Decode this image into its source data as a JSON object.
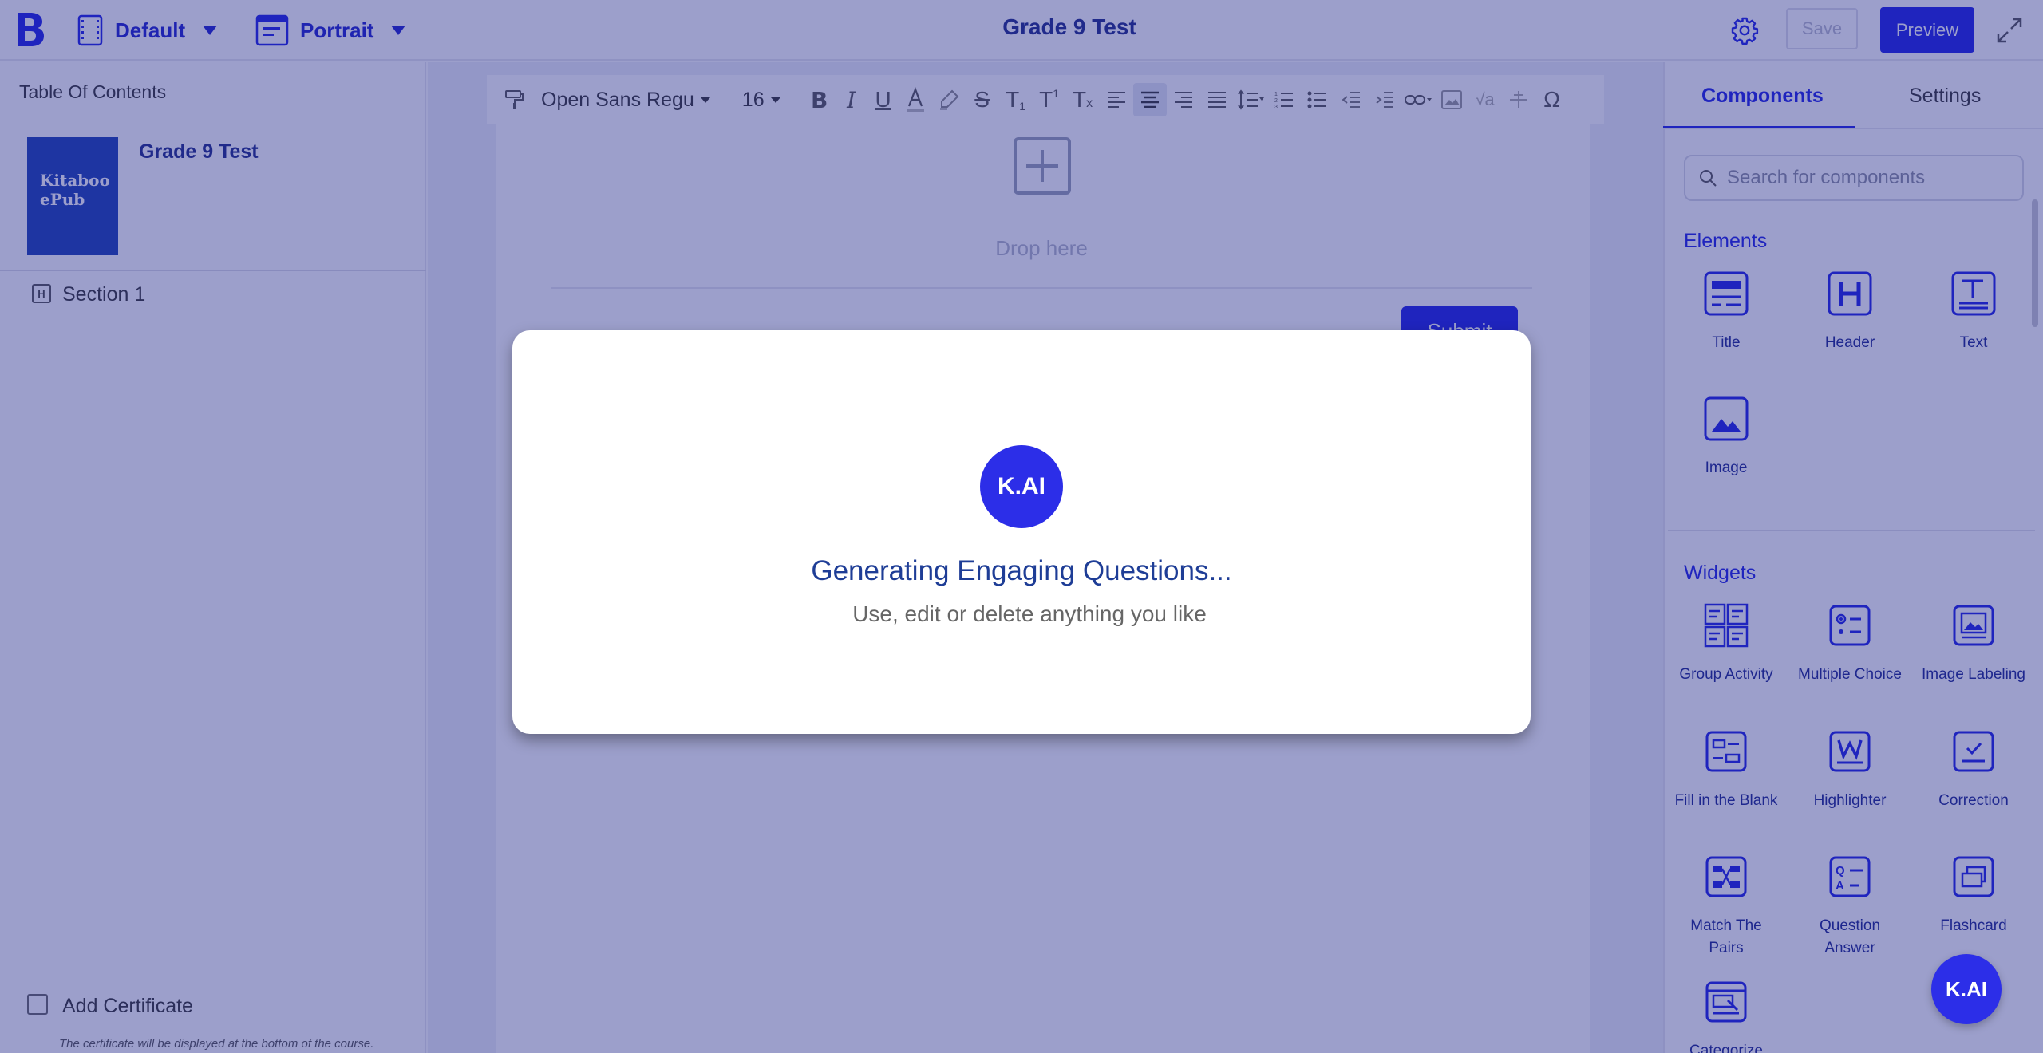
{
  "topbar": {
    "theme_label": "Default",
    "layout_label": "Portrait",
    "title": "Grade 9 Test",
    "save_label": "Save",
    "preview_label": "Preview"
  },
  "left_panel": {
    "toc_title": "Table Of Contents",
    "cover_text_line1": "Kitaboo",
    "cover_text_line2": "ePub",
    "book_title": "Grade 9 Test",
    "section_icon_letter": "H",
    "sections": [
      {
        "label": "Section 1"
      }
    ],
    "certificate_label": "Add Certificate",
    "certificate_note": "The certificate will be displayed at the bottom of the course."
  },
  "toolbar": {
    "font_family": "Open Sans Regu",
    "font_size": "16"
  },
  "canvas": {
    "drop_label": "Drop here",
    "submit_label": "Submit"
  },
  "right_panel": {
    "tabs": [
      {
        "label": "Components"
      },
      {
        "label": "Settings"
      }
    ],
    "search_placeholder": "Search for components",
    "elements_heading": "Elements",
    "elements": [
      {
        "label": "Title",
        "icon": "title-icon"
      },
      {
        "label": "Header",
        "icon": "header-icon"
      },
      {
        "label": "Text",
        "icon": "text-icon"
      },
      {
        "label": "Image",
        "icon": "image-icon"
      }
    ],
    "widgets_heading": "Widgets",
    "widgets": [
      {
        "label": "Group Activity",
        "icon": "group-activity-icon"
      },
      {
        "label": "Multiple Choice",
        "icon": "multiple-choice-icon"
      },
      {
        "label": "Image Labeling",
        "icon": "image-labeling-icon"
      },
      {
        "label": "Fill in the Blank",
        "icon": "fill-in-blank-icon"
      },
      {
        "label": "Highlighter",
        "icon": "highlighter-icon"
      },
      {
        "label": "Correction",
        "icon": "correction-icon"
      },
      {
        "label": "Match The Pairs",
        "icon": "match-pairs-icon"
      },
      {
        "label": "Question Answer",
        "icon": "question-answer-icon"
      },
      {
        "label": "Flashcard",
        "icon": "flashcard-icon"
      },
      {
        "label": "Categorize",
        "icon": "categorize-icon"
      }
    ]
  },
  "modal": {
    "badge": "K.AI",
    "title": "Generating Engaging Questions...",
    "subtitle": "Use, edit or delete anything you like"
  },
  "kai_fab": "K.AI",
  "colors": {
    "accent": "#1c20e8",
    "brand_dark": "#1e2a8a",
    "overlay": "rgba(35,42,140,0.45)"
  }
}
